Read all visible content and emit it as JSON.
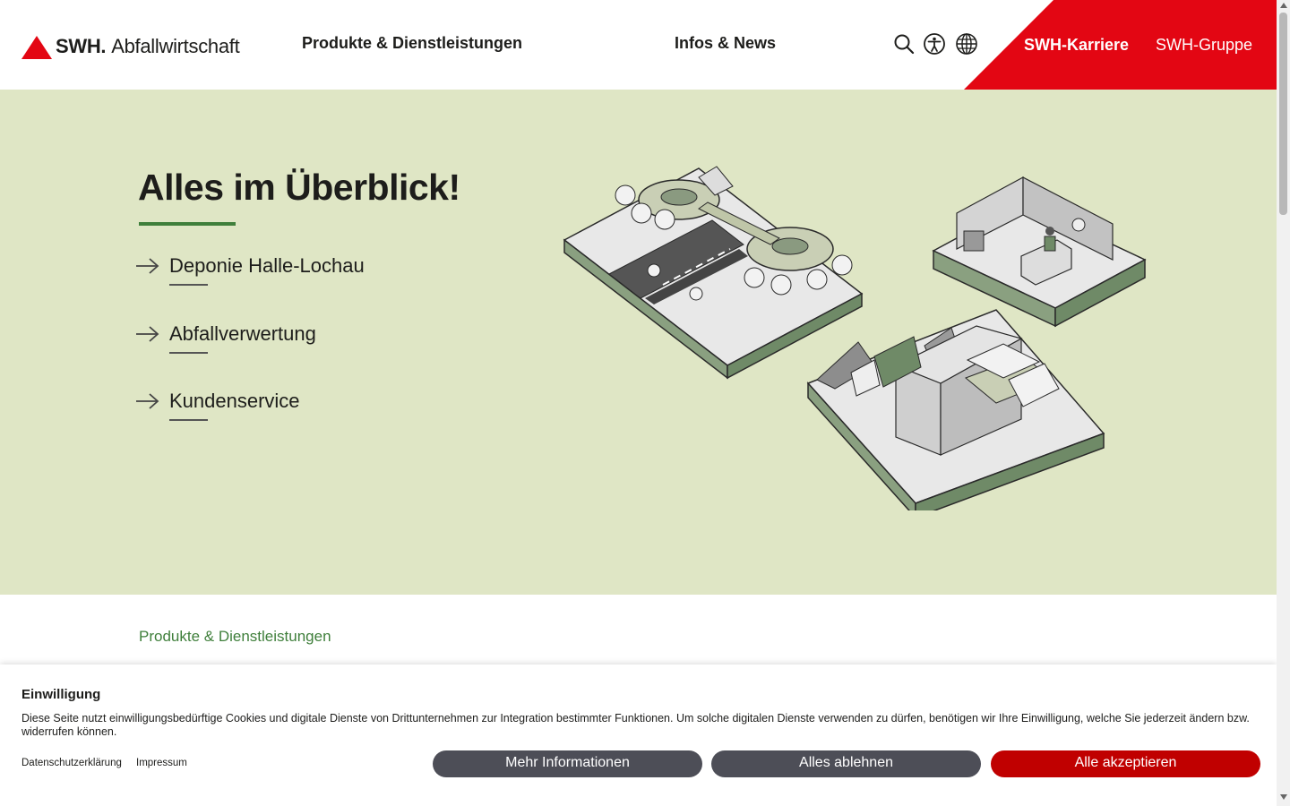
{
  "header": {
    "logo_brand": "SWH.",
    "logo_sub": "Abfallwirtschaft",
    "nav": {
      "produkte": "Produkte & Dienstleistungen",
      "infos": "Infos & News",
      "karriere": "SWH-Karriere",
      "gruppe": "SWH-Gruppe"
    },
    "icons": [
      "search-icon",
      "accessibility-icon",
      "globe-icon"
    ]
  },
  "hero": {
    "title": "Alles im Überblick!",
    "links": [
      {
        "label": "Deponie Halle-Lochau"
      },
      {
        "label": "Abfallverwertung"
      },
      {
        "label": "Kundenservice"
      }
    ]
  },
  "breadcrumb": "Produkte & Dienstleistungen",
  "cookie": {
    "title": "Einwilligung",
    "text": "Diese Seite nutzt einwilligungsbedürftige Cookies und digitale Dienste von Drittunternehmen zur Integration bestimmter Funktionen. Um solche digitalen Dienste verwenden zu dürfen, benötigen wir Ihre Einwilligung, welche Sie jederzeit ändern bzw. widerrufen können.",
    "link_datenschutz": "Datenschutzerklärung",
    "link_impressum": "Impressum",
    "btn_more": "Mehr Informationen",
    "btn_reject": "Alles ablehnen",
    "btn_accept": "Alle akzeptieren"
  },
  "colors": {
    "brand_red": "#e30613",
    "hero_bg": "#dfe6c5",
    "accent_green": "#3f7f3b",
    "button_gray": "#4d4e57",
    "button_red": "#c00000"
  }
}
